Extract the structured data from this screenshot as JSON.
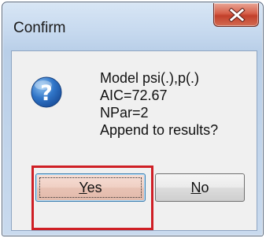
{
  "window": {
    "title": "Confirm",
    "close_label": "X"
  },
  "message": {
    "icon": "question-icon",
    "lines": [
      "Model psi(.),p(.)",
      "AIC=72.67",
      "NPar=2",
      "Append to results?"
    ]
  },
  "buttons": {
    "yes": {
      "accel": "Y",
      "rest": "es"
    },
    "no": {
      "accel": "N",
      "rest": "o"
    }
  },
  "colors": {
    "highlight": "#cf1f25",
    "close_button": "#c2402b",
    "icon_blue": "#1f5fb5"
  }
}
